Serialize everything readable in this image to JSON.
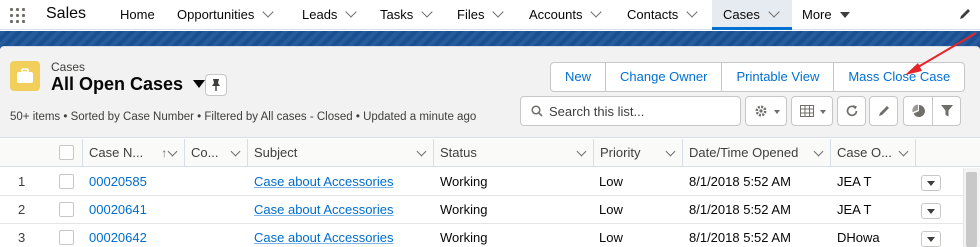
{
  "app": {
    "name": "Sales"
  },
  "nav": {
    "items": [
      {
        "label": "Home"
      },
      {
        "label": "Opportunities"
      },
      {
        "label": "Leads"
      },
      {
        "label": "Tasks"
      },
      {
        "label": "Files"
      },
      {
        "label": "Accounts"
      },
      {
        "label": "Contacts"
      },
      {
        "label": "Cases"
      },
      {
        "label": "More"
      }
    ],
    "active": "Cases"
  },
  "list_view": {
    "object_label": "Cases",
    "title": "All Open Cases",
    "meta": "50+ items • Sorted by Case Number • Filtered by All cases - Closed • Updated a minute ago",
    "actions": [
      "New",
      "Change Owner",
      "Printable View",
      "Mass Close Case"
    ],
    "search_placeholder": "Search this list..."
  },
  "table": {
    "columns": [
      {
        "label": "Case N..."
      },
      {
        "label": "Co..."
      },
      {
        "label": "Subject"
      },
      {
        "label": "Status"
      },
      {
        "label": "Priority"
      },
      {
        "label": "Date/Time Opened"
      },
      {
        "label": "Case O..."
      }
    ],
    "rows": [
      {
        "num": "1",
        "case_number": "00020585",
        "contact": "",
        "subject": "Case about Accessories",
        "status": "Working",
        "priority": "Low",
        "opened": "8/1/2018 5:52 AM",
        "owner": "JEA T"
      },
      {
        "num": "2",
        "case_number": "00020641",
        "contact": "",
        "subject": "Case about Accessories",
        "status": "Working",
        "priority": "Low",
        "opened": "8/1/2018 5:52 AM",
        "owner": "JEA T"
      },
      {
        "num": "3",
        "case_number": "00020642",
        "contact": "",
        "subject": "Case about Accessories",
        "status": "Working",
        "priority": "Low",
        "opened": "8/1/2018 5:52 AM",
        "owner": "DHowa"
      }
    ]
  },
  "colors": {
    "brand_band": "#1b5297",
    "link": "#006dcc",
    "object_icon": "#f2cf5b",
    "active_tab_bar": "#0070d2",
    "annotation_arrow": "#e4252a"
  },
  "icons": {
    "app_launcher": "waffle-icon",
    "nav_edit": "pencil-icon",
    "object": "briefcase-icon",
    "pin": "pin-icon",
    "search": "search-icon",
    "settings": "gear-icon",
    "display": "table-icon",
    "refresh": "refresh-icon",
    "inline_edit": "pencil-icon",
    "charts": "pie-chart-icon",
    "filters": "filter-icon"
  }
}
